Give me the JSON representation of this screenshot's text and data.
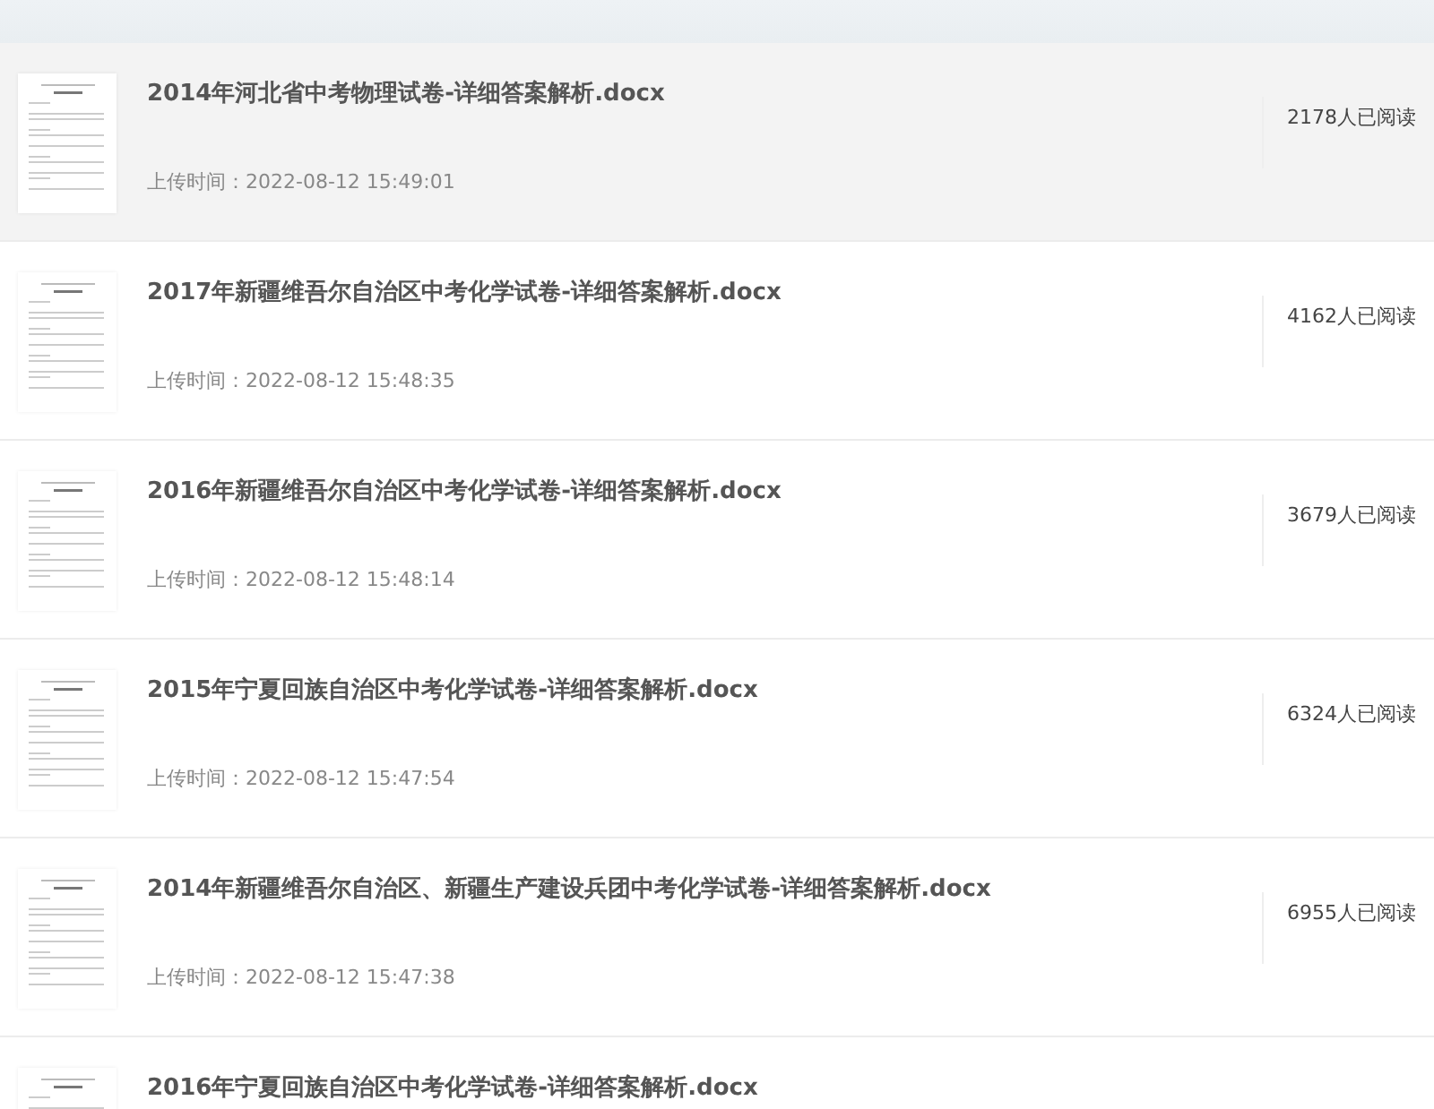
{
  "documents": [
    {
      "title": "2014年河北省中考物理试卷-详细答案解析.docx",
      "upload_time": "上传时间：2022-08-12 15:49:01",
      "reads": "2178人已阅读",
      "highlighted": true
    },
    {
      "title": "2017年新疆维吾尔自治区中考化学试卷-详细答案解析.docx",
      "upload_time": "上传时间：2022-08-12 15:48:35",
      "reads": "4162人已阅读",
      "highlighted": false
    },
    {
      "title": "2016年新疆维吾尔自治区中考化学试卷-详细答案解析.docx",
      "upload_time": "上传时间：2022-08-12 15:48:14",
      "reads": "3679人已阅读",
      "highlighted": false
    },
    {
      "title": "2015年宁夏回族自治区中考化学试卷-详细答案解析.docx",
      "upload_time": "上传时间：2022-08-12 15:47:54",
      "reads": "6324人已阅读",
      "highlighted": false
    },
    {
      "title": "2014年新疆维吾尔自治区、新疆生产建设兵团中考化学试卷-详细答案解析.docx",
      "upload_time": "上传时间：2022-08-12 15:47:38",
      "reads": "6955人已阅读",
      "highlighted": false
    },
    {
      "title": "2016年宁夏回族自治区中考化学试卷-详细答案解析.docx",
      "highlighted": false
    }
  ]
}
